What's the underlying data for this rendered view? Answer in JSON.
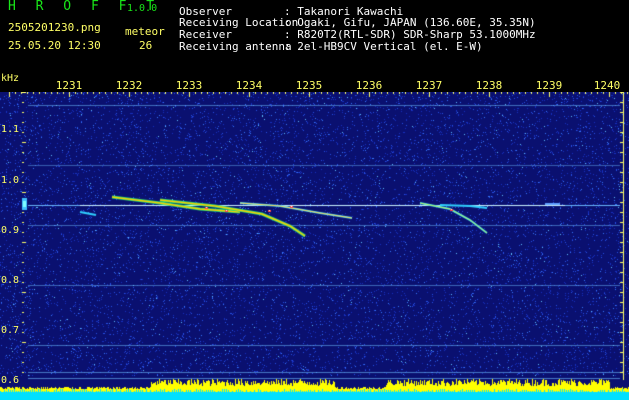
{
  "app": {
    "title": "H R O F F T",
    "version": "1.0.0"
  },
  "file": {
    "name": "2505201230.png",
    "datetime": "25.05.20 12:30"
  },
  "meteor": {
    "label": "meteor",
    "count": "26"
  },
  "info": [
    {
      "key": "Observer",
      "value": ": Takanori Kawachi"
    },
    {
      "key": "Receiving Location",
      "value": ": Ogaki, Gifu, JAPAN (136.60E, 35.35N)"
    },
    {
      "key": "Receiver",
      "value": ": R820T2(RTL-SDR) SDR-Sharp 53.1000MHz"
    },
    {
      "key": "Receiving antenna",
      "value": ": 2el-HB9CV Vertical (el. E-W)"
    }
  ],
  "spectrogram": {
    "y_unit": "kHz",
    "time_ticks": [
      "1231",
      "1232",
      "1233",
      "1234",
      "1235",
      "1236",
      "1237",
      "1238",
      "1239",
      "1240"
    ],
    "freq_ticks": [
      "1.1",
      "1.0",
      "0.9",
      "0.8",
      "0.7",
      "0.6"
    ],
    "colors": {
      "background": "#0a1070",
      "ticks": "#ffff66",
      "audio": "#ffff00",
      "baseline": "#00e0ff"
    }
  }
}
